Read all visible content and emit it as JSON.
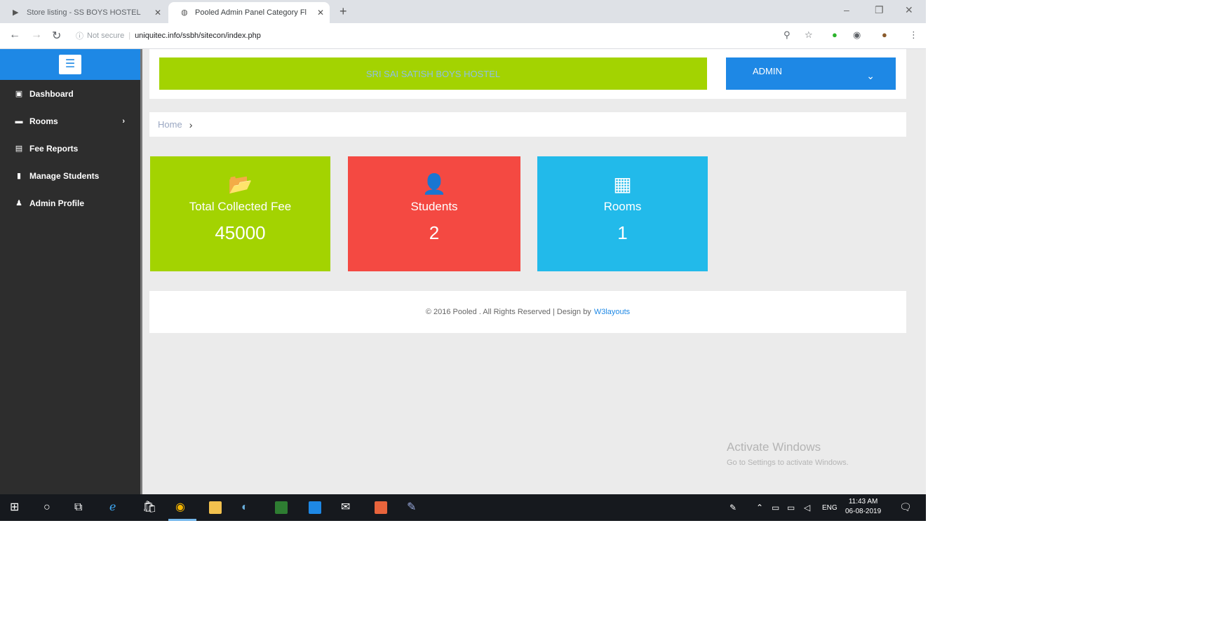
{
  "browser": {
    "tabs": [
      {
        "title": "Store listing - SS BOYS HOSTEL"
      },
      {
        "title": "Pooled Admin Panel Category Fl"
      }
    ],
    "omnibox": {
      "security": "Not secure",
      "url": "uniquitec.info/ssbh/sitecon/index.php"
    }
  },
  "sidebar": {
    "items": [
      {
        "label": "Dashboard",
        "icon": "dashboard-icon"
      },
      {
        "label": "Rooms",
        "icon": "folder-icon",
        "has_submenu": true
      },
      {
        "label": "Fee Reports",
        "icon": "report-icon"
      },
      {
        "label": "Manage Students",
        "icon": "document-icon"
      },
      {
        "label": "Admin Profile",
        "icon": "user-icon"
      }
    ]
  },
  "header": {
    "brand": "SRI SAI SATISH BOYS HOSTEL",
    "admin_label": "ADMIN"
  },
  "breadcrumb": {
    "home": "Home"
  },
  "stats": [
    {
      "label": "Total Collected Fee",
      "value": "45000",
      "icon": "folder-open-icon",
      "color": "#a3d301"
    },
    {
      "label": "Students",
      "value": "2",
      "icon": "user-icon",
      "color": "#f44942"
    },
    {
      "label": "Rooms",
      "value": "1",
      "icon": "building-icon",
      "color": "#22baea"
    }
  ],
  "footer": {
    "text": "© 2016 Pooled . All Rights Reserved | Design by",
    "link": "W3layouts"
  },
  "watermark": {
    "title": "Activate Windows",
    "subtitle": "Go to Settings to activate Windows."
  },
  "taskbar": {
    "language": "ENG",
    "time": "11:43 AM",
    "date": "06-08-2019"
  },
  "colors": {
    "accent_blue": "#1e88e5",
    "sidebar_bg": "#2d2d2d",
    "brand_green": "#a3d301",
    "students_red": "#f44942",
    "rooms_cyan": "#22baea"
  }
}
